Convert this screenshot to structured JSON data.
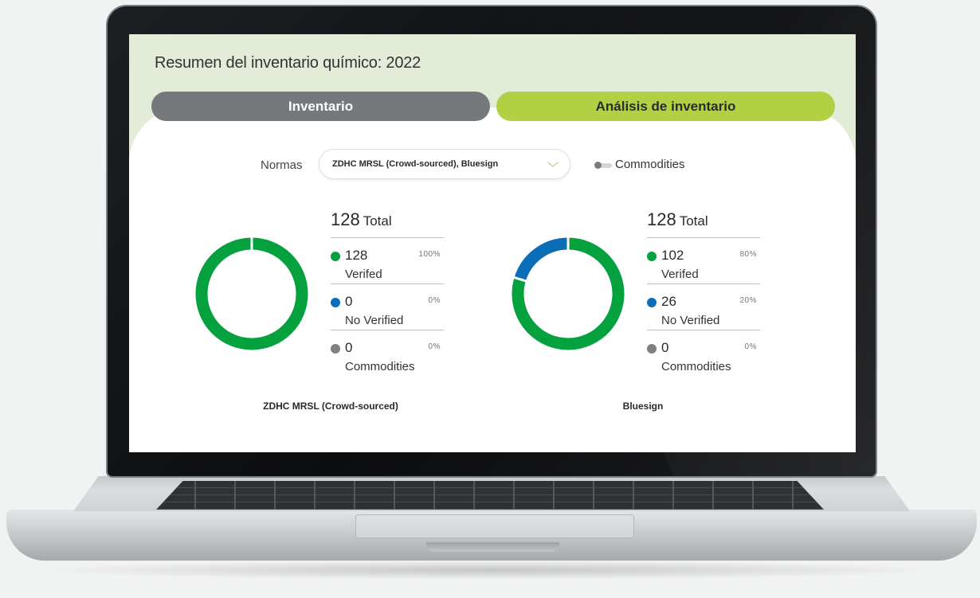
{
  "app": {
    "page_title": "Resumen del inventario químico: 2022"
  },
  "tabs": [
    {
      "label": "Inventario",
      "active": false
    },
    {
      "label": "Análisis de inventario",
      "active": true
    }
  ],
  "filters": {
    "normas_label": "Normas",
    "normas_value": "ZDHC MRSL (Crowd-sourced), Bluesign",
    "commodities_toggle_label": "Commodities",
    "commodities_toggle_on": false
  },
  "colors": {
    "verified": "#04a13e",
    "no_verified": "#0b6db6",
    "commodities": "#808080",
    "tab_active": "#b2d043",
    "tab_inactive": "#76797c",
    "screen_background": "#e3ecd6"
  },
  "panels": [
    {
      "caption": "ZDHC MRSL (Crowd-sourced)",
      "total_value": "128",
      "total_label": "Total",
      "rows": [
        {
          "value": "128",
          "label": "Verifed",
          "percent": "100%"
        },
        {
          "value": "0",
          "label": "No Verified",
          "percent": "0%"
        },
        {
          "value": "0",
          "label": "Commodities",
          "percent": "0%"
        }
      ]
    },
    {
      "caption": "Bluesign",
      "total_value": "128",
      "total_label": "Total",
      "rows": [
        {
          "value": "102",
          "label": "Verifed",
          "percent": "80%"
        },
        {
          "value": "26",
          "label": "No Verified",
          "percent": "20%"
        },
        {
          "value": "0",
          "label": "Commodities",
          "percent": "0%"
        }
      ]
    }
  ],
  "chart_data": [
    {
      "type": "pie",
      "title": "ZDHC MRSL (Crowd-sourced)",
      "categories": [
        "Verifed",
        "No Verified",
        "Commodities"
      ],
      "values": [
        128,
        0,
        0
      ]
    },
    {
      "type": "pie",
      "title": "Bluesign",
      "categories": [
        "Verifed",
        "No Verified",
        "Commodities"
      ],
      "values": [
        102,
        26,
        0
      ]
    }
  ]
}
